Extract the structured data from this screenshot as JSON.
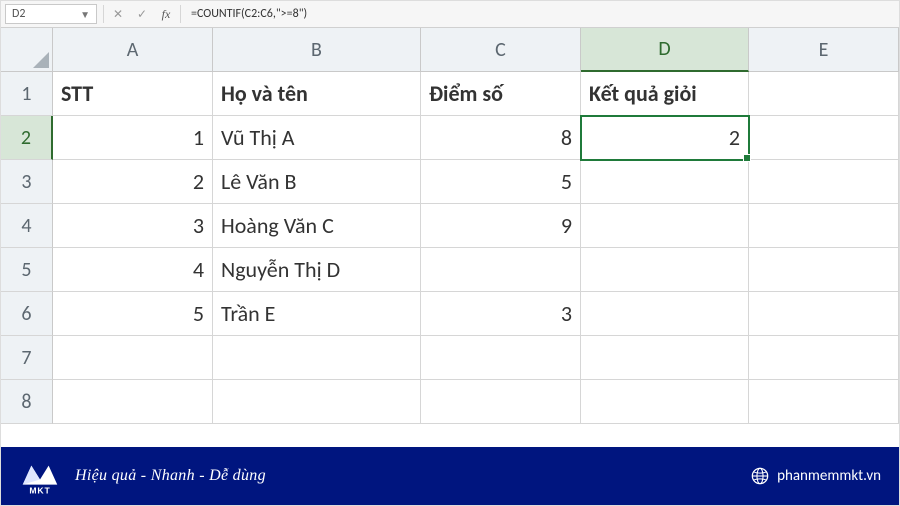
{
  "formula_bar": {
    "name_box": "D2",
    "formula": "=COUNTIF(C2:C6,\">=8\")"
  },
  "columns": [
    "A",
    "B",
    "C",
    "D",
    "E"
  ],
  "rows": [
    "1",
    "2",
    "3",
    "4",
    "5",
    "6",
    "7",
    "8"
  ],
  "active_cell": {
    "col": "D",
    "row": "2"
  },
  "headers": {
    "A": "STT",
    "B": "Họ và tên",
    "C": "Điểm số",
    "D": "Kết quả giỏi"
  },
  "data": {
    "r2": {
      "A": "1",
      "B": "Vũ Thị A",
      "C": "8",
      "D": "2"
    },
    "r3": {
      "A": "2",
      "B": "Lê Văn B",
      "C": "5"
    },
    "r4": {
      "A": "3",
      "B": "Hoàng Văn C",
      "C": "9"
    },
    "r5": {
      "A": "4",
      "B": "Nguyễn Thị D"
    },
    "r6": {
      "A": "5",
      "B": "Trần E",
      "C": "3"
    }
  },
  "footer": {
    "brand": "MKT",
    "tagline": "Hiệu quả - Nhanh - Dễ dùng",
    "site": "phanmemmkt.vn"
  },
  "chart_data": {
    "type": "table",
    "columns": [
      "STT",
      "Họ và tên",
      "Điểm số",
      "Kết quả giỏi"
    ],
    "rows": [
      [
        1,
        "Vũ Thị A",
        8,
        2
      ],
      [
        2,
        "Lê Văn B",
        5,
        null
      ],
      [
        3,
        "Hoàng Văn C",
        9,
        null
      ],
      [
        4,
        "Nguyễn Thị D",
        null,
        null
      ],
      [
        5,
        "Trần E",
        3,
        null
      ]
    ],
    "formula_D2": "=COUNTIF(C2:C6,\">=8\")"
  }
}
